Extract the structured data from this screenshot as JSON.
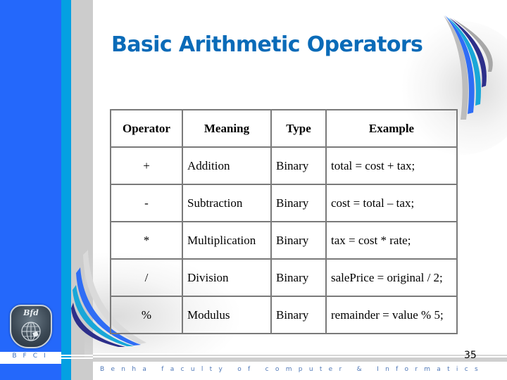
{
  "slide": {
    "title": "Basic Arithmetic Operators",
    "page_number": "35",
    "sidebar_label": "BFCI",
    "footer_text": "Benha faculty of computer & Informatics",
    "logo_text": "Bfd",
    "colors": {
      "sidebar_blue": "#2468fb",
      "sidebar_cyan": "#04a0e2",
      "sidebar_gray": "#cccccc",
      "title": "#0a6bb8",
      "table_border": "#7a7a7a"
    }
  },
  "table": {
    "headers": [
      "Operator",
      "Meaning",
      "Type",
      "Example"
    ],
    "rows": [
      [
        "+",
        "Addition",
        "Binary",
        "total = cost + tax;"
      ],
      [
        "-",
        "Subtraction",
        "Binary",
        "cost = total – tax;"
      ],
      [
        "*",
        "Multiplication",
        "Binary",
        "tax = cost * rate;"
      ],
      [
        "/",
        "Division",
        "Binary",
        "salePrice = original / 2;"
      ],
      [
        "%",
        "Modulus",
        "Binary",
        "remainder = value % 5;"
      ]
    ]
  }
}
